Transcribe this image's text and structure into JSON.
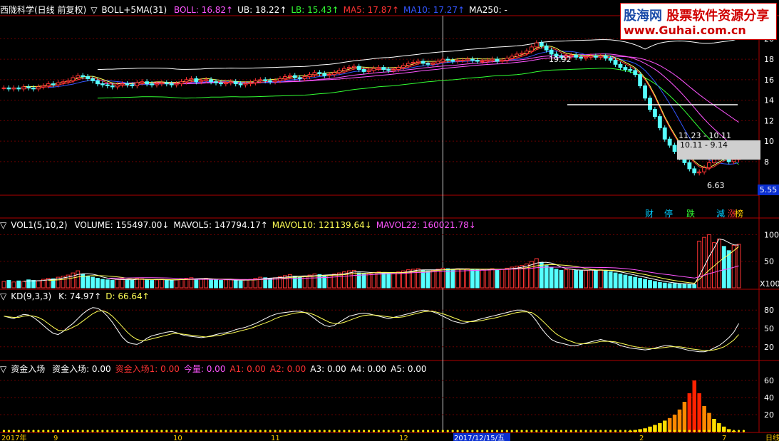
{
  "main": {
    "title": "西陇科学(日线 前复权)",
    "indicator": "BOLL+5MA(31)",
    "legend": [
      {
        "label": "BOLL: 16.82",
        "arrow": "↑",
        "color": "#ff55ff"
      },
      {
        "label": "UB: 18.22",
        "arrow": "↑",
        "color": "#ffffff"
      },
      {
        "label": "LB: 15.43",
        "arrow": "↑",
        "color": "#33ff33"
      },
      {
        "label": "MA5: 17.87",
        "arrow": "↑",
        "color": "#ff3333"
      },
      {
        "label": "MA10: 17.27",
        "arrow": "↑",
        "color": "#3355ff"
      },
      {
        "label": "MA250: -",
        "arrow": "",
        "color": "#ffffff"
      }
    ],
    "yticks": [
      "20",
      "18",
      "16",
      "14",
      "12",
      "10",
      "8"
    ],
    "current_price": "5.55",
    "high_label": "19.92",
    "low_label": "6.63",
    "gap_labels": [
      "11.23 - 10.11",
      "10.11 - 9.14"
    ],
    "signals": [
      {
        "text": "财",
        "color": "#00ccff"
      },
      {
        "text": "停",
        "color": "#00ccff"
      },
      {
        "text": "跌",
        "color": "#33ff33"
      },
      {
        "text": "減",
        "color": "#00ccff"
      },
      {
        "text": "涨",
        "color": "#ff3333"
      },
      {
        "text": "榜",
        "color": "#ffcc00"
      }
    ]
  },
  "volume": {
    "indicator": "VOL1(5,10,2)",
    "legend": [
      {
        "label": "VOLUME: 155497.00",
        "arrow": "↓",
        "color": "#ffffff"
      },
      {
        "label": "MAVOL5: 147794.17",
        "arrow": "↑",
        "color": "#ffffff"
      },
      {
        "label": "MAVOL10: 121139.64",
        "arrow": "↓",
        "color": "#ffff55"
      },
      {
        "label": "MAVOL22: 160021.78",
        "arrow": "↓",
        "color": "#ff55ff"
      }
    ],
    "yticks": [
      "100",
      "50"
    ],
    "unit": "X100"
  },
  "kd": {
    "indicator": "KD(9,3,3)",
    "legend": [
      {
        "label": "K: 74.97",
        "arrow": "↑",
        "color": "#ffffff"
      },
      {
        "label": "D: 66.64",
        "arrow": "↑",
        "color": "#ffff55"
      }
    ],
    "yticks": [
      "80",
      "50",
      "20"
    ]
  },
  "fund": {
    "indicator": "资金入场",
    "legend": [
      {
        "label": "资金入场: 0.00",
        "arrow": "",
        "color": "#ffffff"
      },
      {
        "label": "资金入场1: 0.00",
        "arrow": "",
        "color": "#ff3333"
      },
      {
        "label": "今量: 0.00",
        "arrow": "",
        "color": "#ff55ff"
      },
      {
        "label": "A1: 0.00",
        "arrow": "",
        "color": "#ff3333"
      },
      {
        "label": "A2: 0.00",
        "arrow": "",
        "color": "#ff3333"
      },
      {
        "label": "A3: 0.00",
        "arrow": "",
        "color": "#ffffff"
      },
      {
        "label": "A4: 0.00",
        "arrow": "",
        "color": "#ffffff"
      },
      {
        "label": "A5: 0.00",
        "arrow": "",
        "color": "#ffffff"
      }
    ],
    "yticks": [
      "60",
      "40",
      "20"
    ]
  },
  "xaxis": {
    "labels": [
      "2017年",
      "9",
      "10",
      "11",
      "12",
      "2017/12/15/五",
      "2",
      "7",
      "日线"
    ]
  },
  "badge": {
    "line1_a": "股海网",
    "line1_b": "股票软件资源分享",
    "line2": "www.Guhai.com.cn"
  },
  "chart_data": {
    "type": "candlestick",
    "bar_count": 150,
    "cursor_index": 89,
    "price_range": [
      5,
      21
    ],
    "close": [
      15.2,
      15.1,
      15.2,
      15.1,
      15.3,
      15.2,
      15.1,
      15.3,
      15.4,
      15.6,
      15.5,
      15.7,
      15.8,
      15.9,
      16.2,
      16.4,
      16.3,
      16.1,
      15.9,
      15.6,
      15.5,
      15.4,
      15.3,
      15.5,
      15.6,
      15.5,
      15.4,
      15.7,
      15.8,
      15.6,
      15.5,
      15.6,
      15.7,
      15.6,
      15.5,
      15.6,
      15.8,
      16.0,
      16.1,
      15.8,
      15.9,
      16.0,
      15.8,
      15.7,
      15.6,
      15.7,
      15.8,
      15.6,
      15.5,
      15.6,
      15.7,
      15.9,
      16.0,
      15.9,
      15.8,
      15.9,
      16.1,
      16.3,
      16.4,
      16.2,
      16.1,
      16.3,
      16.5,
      16.7,
      16.6,
      16.4,
      16.5,
      16.7,
      16.9,
      17.1,
      17.2,
      17.3,
      17.0,
      16.8,
      16.9,
      17.1,
      17.2,
      17.0,
      16.9,
      17.0,
      17.2,
      17.4,
      17.6,
      17.7,
      17.8,
      17.6,
      17.5,
      17.6,
      17.8,
      18.0,
      17.9,
      17.8,
      17.9,
      17.9,
      18.0,
      17.9,
      17.8,
      17.8,
      17.9,
      18.0,
      17.8,
      17.9,
      18.1,
      18.3,
      18.5,
      18.6,
      18.8,
      19.2,
      19.6,
      19.3,
      18.9,
      18.5,
      18.3,
      18.2,
      18.3,
      18.4,
      18.2,
      18.1,
      18.2,
      18.3,
      18.2,
      18.3,
      18.1,
      17.9,
      17.5,
      17.2,
      17.0,
      16.9,
      16.5,
      15.4,
      14.2,
      13.1,
      12.4,
      11.3,
      10.2,
      9.6,
      9.0,
      8.4,
      7.9,
      7.3,
      6.9,
      7.0,
      7.4,
      7.9,
      8.3,
      8.5,
      8.3,
      8.0,
      8.2,
      8.5
    ],
    "volume": [
      12,
      14,
      11,
      13,
      12,
      15,
      14,
      13,
      16,
      18,
      17,
      20,
      22,
      24,
      28,
      32,
      26,
      22,
      20,
      18,
      16,
      15,
      14,
      16,
      17,
      15,
      14,
      18,
      17,
      15,
      14,
      15,
      16,
      15,
      14,
      15,
      17,
      18,
      19,
      16,
      17,
      18,
      16,
      15,
      14,
      15,
      16,
      14,
      13,
      15,
      16,
      18,
      20,
      19,
      18,
      19,
      21,
      23,
      25,
      22,
      20,
      22,
      24,
      26,
      25,
      23,
      24,
      26,
      28,
      30,
      32,
      33,
      28,
      26,
      27,
      29,
      30,
      28,
      27,
      28,
      30,
      32,
      34,
      35,
      36,
      33,
      32,
      33,
      35,
      37,
      36,
      35,
      36,
      35,
      36,
      35,
      34,
      34,
      35,
      36,
      34,
      35,
      37,
      39,
      41,
      42,
      45,
      50,
      55,
      48,
      42,
      38,
      35,
      33,
      34,
      35,
      33,
      32,
      33,
      34,
      33,
      34,
      32,
      30,
      28,
      26,
      24,
      22,
      20,
      18,
      16,
      14,
      12,
      10,
      9,
      8,
      8,
      7,
      7,
      6,
      6,
      88,
      95,
      100,
      85,
      92,
      78,
      70,
      80,
      82
    ],
    "k": [
      70,
      68,
      66,
      70,
      73,
      72,
      68,
      62,
      55,
      48,
      42,
      40,
      45,
      52,
      58,
      66,
      74,
      80,
      84,
      83,
      78,
      70,
      60,
      48,
      36,
      28,
      25,
      24,
      28,
      34,
      38,
      40,
      42,
      44,
      45,
      43,
      40,
      38,
      37,
      36,
      35,
      36,
      38,
      40,
      42,
      43,
      45,
      48,
      50,
      52,
      55,
      58,
      62,
      66,
      70,
      73,
      75,
      76,
      77,
      78,
      78,
      76,
      72,
      66,
      60,
      55,
      53,
      55,
      60,
      65,
      70,
      72,
      74,
      75,
      74,
      72,
      70,
      68,
      66,
      68,
      70,
      72,
      74,
      76,
      78,
      80,
      79,
      77,
      74,
      70,
      66,
      62,
      60,
      58,
      60,
      62,
      64,
      66,
      68,
      70,
      72,
      74,
      76,
      78,
      80,
      80,
      78,
      72,
      62,
      50,
      40,
      32,
      28,
      26,
      24,
      22,
      22,
      24,
      26,
      28,
      30,
      32,
      30,
      28,
      26,
      22,
      20,
      18,
      17,
      16,
      15,
      16,
      18,
      20,
      22,
      22,
      20,
      18,
      16,
      14,
      13,
      12,
      12,
      14,
      18,
      22,
      28,
      35,
      44,
      58
    ],
    "d": [
      70,
      69,
      68,
      68,
      70,
      71,
      70,
      68,
      64,
      58,
      52,
      47,
      46,
      48,
      52,
      56,
      62,
      68,
      74,
      78,
      79,
      76,
      70,
      62,
      53,
      44,
      37,
      32,
      30,
      31,
      33,
      35,
      37,
      39,
      41,
      42,
      41,
      40,
      39,
      38,
      37,
      36,
      37,
      38,
      39,
      41,
      42,
      44,
      46,
      48,
      50,
      53,
      56,
      59,
      62,
      66,
      69,
      71,
      73,
      75,
      76,
      76,
      75,
      72,
      68,
      64,
      60,
      58,
      58,
      60,
      63,
      66,
      69,
      71,
      72,
      72,
      71,
      70,
      69,
      68,
      68,
      69,
      71,
      73,
      75,
      77,
      78,
      78,
      76,
      74,
      71,
      68,
      65,
      62,
      61,
      61,
      62,
      63,
      65,
      66,
      68,
      70,
      72,
      74,
      76,
      77,
      77,
      76,
      71,
      64,
      56,
      48,
      41,
      36,
      32,
      29,
      26,
      25,
      25,
      26,
      27,
      29,
      29,
      29,
      28,
      26,
      24,
      22,
      20,
      19,
      18,
      17,
      17,
      18,
      19,
      20,
      20,
      20,
      19,
      17,
      16,
      15,
      14,
      14,
      15,
      17,
      20,
      25,
      31,
      40
    ],
    "fund": [
      0,
      0,
      0,
      0,
      0,
      0,
      0,
      0,
      0,
      0,
      0,
      0,
      0,
      0,
      0,
      0,
      0,
      0,
      0,
      0,
      0,
      0,
      0,
      0,
      0,
      0,
      0,
      0,
      0,
      0,
      0,
      0,
      0,
      0,
      0,
      0,
      0,
      0,
      0,
      0,
      0,
      0,
      0,
      0,
      0,
      0,
      0,
      0,
      0,
      0,
      0,
      0,
      0,
      0,
      0,
      0,
      0,
      0,
      0,
      0,
      0,
      0,
      0,
      0,
      0,
      0,
      0,
      0,
      0,
      0,
      0,
      0,
      0,
      0,
      0,
      0,
      0,
      0,
      0,
      0,
      0,
      0,
      0,
      0,
      0,
      0,
      0,
      0,
      0,
      0,
      0,
      0,
      0,
      0,
      0,
      0,
      0,
      0,
      0,
      0,
      0,
      0,
      0,
      0,
      0,
      0,
      0,
      0,
      0,
      0,
      0,
      0,
      0,
      0,
      0,
      0,
      0,
      0,
      0,
      0,
      0,
      0,
      0,
      0,
      0,
      0,
      0,
      1,
      2,
      3,
      4,
      6,
      8,
      10,
      13,
      16,
      20,
      26,
      35,
      45,
      60,
      45,
      30,
      22,
      15,
      10,
      6,
      3,
      1,
      0,
      0
    ]
  }
}
